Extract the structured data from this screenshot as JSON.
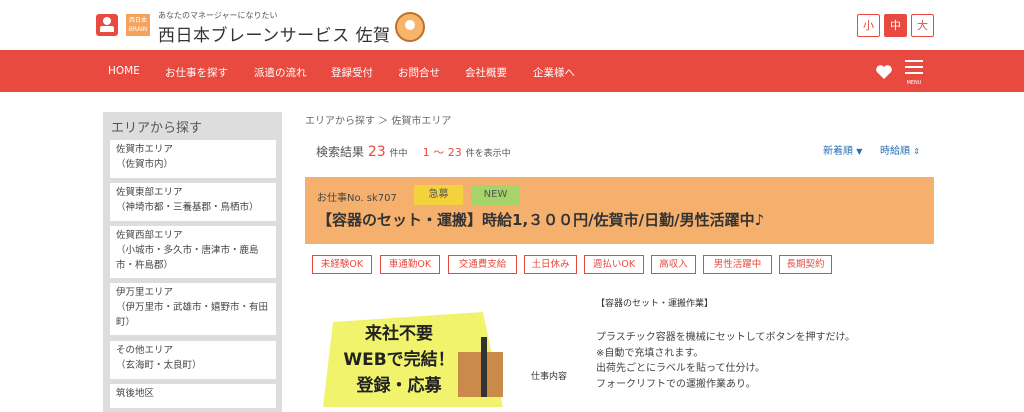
{
  "header": {
    "tagline": "あなたのマネージャーになりたい",
    "badge_text": "西日本BRAIN",
    "brand": "西日本ブレーンサービス 佐賀",
    "font_sizes": [
      "小",
      "中",
      "大"
    ],
    "active_font_size": "中",
    "brand_color": "#e84a3f"
  },
  "nav": {
    "items": [
      "HOME",
      "お仕事を探す",
      "派遣の流れ",
      "登録受付",
      "お問合せ",
      "会社概要",
      "企業様へ"
    ],
    "menu_label": "MENU",
    "icons": [
      "heart-icon",
      "hamburger-menu-icon"
    ]
  },
  "sidebar": {
    "title": "エリアから探す",
    "items": [
      {
        "name": "佐賀市エリア",
        "sub": "（佐賀市内）"
      },
      {
        "name": "佐賀東部エリア",
        "sub": "（神埼市都・三養基郡・鳥栖市）"
      },
      {
        "name": "佐賀西部エリア",
        "sub": "（小城市・多久市・唐津市・鹿島市・杵島郡）"
      },
      {
        "name": "伊万里エリア",
        "sub": "（伊万里市・武雄市・嬉野市・有田町）"
      },
      {
        "name": "その他エリア",
        "sub": "（玄海町・太良町）"
      },
      {
        "name": "筑後地区",
        "sub": ""
      }
    ]
  },
  "breadcrumb": "エリアから探す ＞ 佐賀市エリア",
  "results": {
    "label": "検索結果",
    "count": "23",
    "count_unit": "件中",
    "range": "1 ～ 23",
    "range_suffix": "件を表示中",
    "sort_new": "新着順",
    "sort_wage": "時給順"
  },
  "job": {
    "number": "お仕事No. sk707",
    "badge_urgent": "急募",
    "badge_new": "NEW",
    "title": "【容器のセット・運搬】時給1,３００円/佐賀市/日勤/男性活躍中♪",
    "tags": [
      "未経験OK",
      "車通勤OK",
      "交通費支給",
      "土日休み",
      "週払いOK",
      "高収入",
      "男性活躍中",
      "長期契約"
    ],
    "promo_lines": [
      "来社不要",
      "WEBで完結！",
      "登録・応募"
    ],
    "section_label": "仕事内容",
    "detail_title": "【容器のセット・運搬作業】",
    "detail_lines": [
      "プラスチック容器を機械にセットしてボタンを押すだけ。",
      "※自動で充填されます。",
      "出荷先ごとにラベルを貼って仕分け。",
      "フォークリフトでの運搬作業あり。"
    ]
  }
}
